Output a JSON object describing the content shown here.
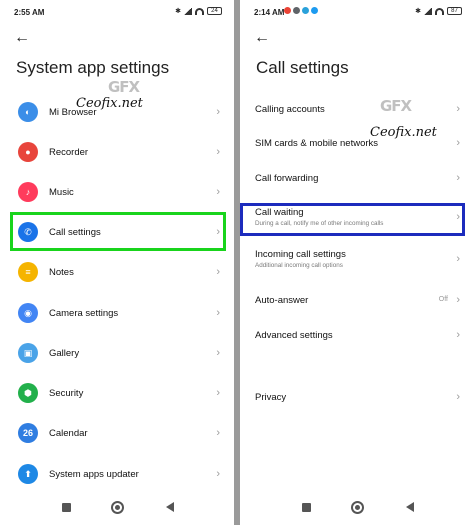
{
  "left": {
    "status": {
      "time": "2:55 AM",
      "battery": "24"
    },
    "title": "System app settings",
    "items": [
      {
        "label": "Mi Browser",
        "icon": "mi-browser-icon",
        "color": "#3b8ee8"
      },
      {
        "label": "Recorder",
        "icon": "microphone-icon",
        "color": "#e8453c"
      },
      {
        "label": "Music",
        "icon": "music-note-icon",
        "color": "#ff3b5c"
      },
      {
        "label": "Call settings",
        "icon": "phone-icon",
        "color": "#1a73e8"
      },
      {
        "label": "Notes",
        "icon": "notes-icon",
        "color": "#f5b400"
      },
      {
        "label": "Camera settings",
        "icon": "camera-icon",
        "color": "#4285f4"
      },
      {
        "label": "Gallery",
        "icon": "gallery-icon",
        "color": "#4aa3e8"
      },
      {
        "label": "Security",
        "icon": "security-shield-icon",
        "color": "#22b04b"
      },
      {
        "label": "Calendar",
        "icon": "calendar-icon",
        "color": "#2f7de1",
        "icon_text": "26"
      },
      {
        "label": "System apps updater",
        "icon": "updater-icon",
        "color": "#1e88e5"
      }
    ]
  },
  "right": {
    "status": {
      "time": "2:14 AM",
      "battery": "87"
    },
    "title": "Call settings",
    "items": [
      {
        "label": "Calling accounts",
        "sub": ""
      },
      {
        "label": "SIM cards & mobile networks",
        "sub": ""
      },
      {
        "label": "Call forwarding",
        "sub": ""
      },
      {
        "label": "Call waiting",
        "sub": "During a call, notify me of other incoming calls"
      },
      {
        "label": "Incoming call settings",
        "sub": "Additional incoming call options"
      },
      {
        "label": "Auto-answer",
        "sub": "",
        "value": "Off"
      },
      {
        "label": "Advanced settings",
        "sub": ""
      },
      {
        "label": "Privacy",
        "sub": ""
      }
    ]
  },
  "watermark": {
    "text": "Ceofix.net",
    "logo": "GFX"
  },
  "colors": {
    "highlight_green": "#19d41c",
    "highlight_blue": "#1c2bbd"
  }
}
